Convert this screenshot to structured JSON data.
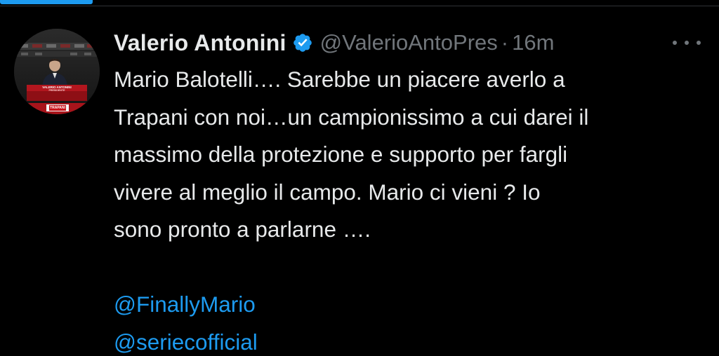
{
  "colors": {
    "background": "#000000",
    "text": "#e7e9ea",
    "secondary": "#71767b",
    "accent": "#1d9bf0"
  },
  "tweet": {
    "display_name": "Valerio Antonini",
    "verified_icon": "verified-badge-icon",
    "handle": "@ValerioAntoPres",
    "separator": "·",
    "time": "16m",
    "more_icon": "more-dots-icon",
    "avatar_caption_lines": [
      "VALERIO ANTONINI",
      "PRESIDENTE"
    ],
    "avatar_logo_text": "TRAPANI",
    "text_lines": [
      "Mario Balotelli…. Sarebbe un piacere averlo a",
      "Trapani con noi…un campionissimo a cui darei il",
      "massimo della protezione e supporto per fargli",
      "vivere al meglio il campo. Mario ci vieni ? Io",
      "sono pronto a parlarne …."
    ],
    "mentions": [
      "@FinallyMario",
      "@seriecofficial"
    ]
  }
}
